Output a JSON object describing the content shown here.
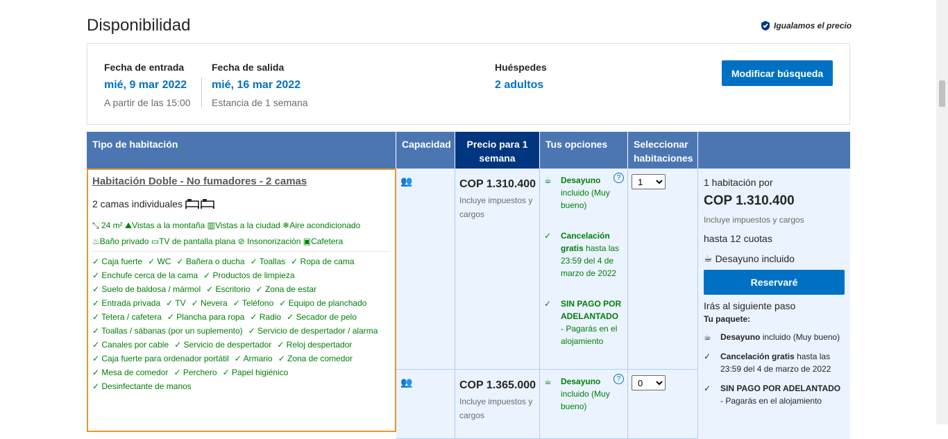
{
  "header": {
    "title": "Disponibilidad",
    "price_match": "Igualamos el precio"
  },
  "search": {
    "checkin_label": "Fecha de entrada",
    "checkin_value": "mié, 9 mar 2022",
    "checkin_sub": "A partir de las 15:00",
    "checkout_label": "Fecha de salida",
    "checkout_value": "mié, 16 mar 2022",
    "checkout_sub": "Estancia de 1 semana",
    "guests_label": "Huéspedes",
    "guests_value": "2 adultos",
    "modify_button": "Modificar búsqueda"
  },
  "table": {
    "headers": {
      "room": "Tipo de habitación",
      "capacity": "Capacidad",
      "price": "Precio para 1 semana",
      "options": "Tus opciones",
      "select": "Seleccionar habitaciones"
    },
    "room": {
      "name": "Habitación Doble - No fumadores - 2 camas",
      "beds": "2 camas individuales",
      "facilities_row1": [
        "24 m²",
        "Vistas a la montaña",
        "Vistas a la ciudad",
        "Aire acondicionado"
      ],
      "facilities_row2": [
        "Baño privado",
        "TV de pantalla plana",
        "Insonorización",
        "Cafetera"
      ],
      "amenities": [
        [
          "Caja fuerte",
          "WC",
          "Bañera o ducha",
          "Toallas",
          "Ropa de cama"
        ],
        [
          "Enchufe cerca de la cama",
          "Productos de limpieza"
        ],
        [
          "Suelo de baldosa / mármol",
          "Escritorio",
          "Zona de estar"
        ],
        [
          "Entrada privada",
          "TV",
          "Nevera",
          "Teléfono",
          "Equipo de planchado"
        ],
        [
          "Tetera / cafetera",
          "Plancha para ropa",
          "Radio",
          "Secador de pelo"
        ],
        [
          "Toallas / sábanas (por un suplemento)",
          "Servicio de despertador / alarma"
        ],
        [
          "Canales por cable",
          "Servicio de despertador",
          "Reloj despertador"
        ],
        [
          "Caja fuerte para ordenador portátil",
          "Armario",
          "Zona de comedor"
        ],
        [
          "Mesa de comedor",
          "Perchero",
          "Papel higiénico"
        ],
        [
          "Desinfectante de manos"
        ]
      ]
    },
    "offer1": {
      "price": "COP 1.310.400",
      "tax": "Incluye impuestos y cargos",
      "breakfast_b": "Desayuno",
      "breakfast_rest": "incluido (Muy bueno)",
      "cancel_b": "Cancelación gratis",
      "cancel_rest": "hasta las 23:59 del 4 de marzo de 2022",
      "nopay_b": "SIN PAGO POR ADELANTADO",
      "nopay_rest": "- Pagarás en el alojamiento",
      "qty": "1"
    },
    "offer2": {
      "price": "COP 1.365.000",
      "tax": "Incluye impuestos y cargos",
      "breakfast_b": "Desayuno",
      "breakfast_rest": "incluido (Muy bueno)",
      "qty": "0"
    },
    "reserve": {
      "rooms_for": "1 habitación por",
      "total": "COP 1.310.400",
      "tax": "Incluye impuestos y cargos",
      "installments": "hasta 12 cuotas",
      "breakfast": "Desayuno incluido",
      "button": "Reservaré",
      "next_step": "Irás al siguiente paso",
      "package_label": "Tu paquete:",
      "pkg_breakfast_b": "Desayuno",
      "pkg_breakfast_rest": "incluido (Muy bueno)",
      "pkg_cancel_b": "Cancelación gratis",
      "pkg_cancel_rest": "hasta las 23:59 del 4 de marzo de 2022",
      "pkg_nopay_b": "SIN PAGO POR ADELANTADO",
      "pkg_nopay_rest": "- Pagarás en el alojamiento"
    }
  }
}
